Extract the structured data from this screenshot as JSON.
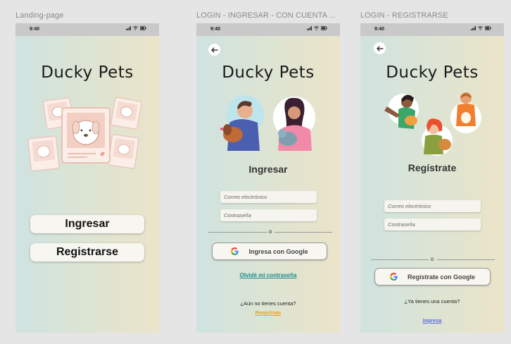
{
  "frames": {
    "landing": {
      "label": "Landing-page"
    },
    "login": {
      "label": "LOGIN - INGRESAR - CON CUENTA ..."
    },
    "register": {
      "label": "LOGIN - REGISTRARSE"
    }
  },
  "status": {
    "time": "9:40"
  },
  "logo": "Ducky Pets",
  "landing": {
    "login_button": "Ingresar",
    "register_button": "Registrarse"
  },
  "login": {
    "title": "Ingresar",
    "email_placeholder": "Correo electrónico",
    "password_placeholder": "Contraseña",
    "divider_text": "o",
    "google_button": "Ingresa con Google",
    "forgot_password": "Olvidé mi contraseña",
    "no_account": "¿Aún no tienes cuenta?",
    "register_link": "Regístrate"
  },
  "register": {
    "title": "Regístrate",
    "email_placeholder": "Correo electrónico",
    "password_placeholder": "Contraseña",
    "divider_text": "o",
    "google_button": "Regístrate con Google",
    "have_account": "¿Ya tienes una cuenta?",
    "login_link": "Ingresa"
  },
  "colors": {
    "forgot_link": "#1a8a8a",
    "register_link": "#f0a020",
    "login_link": "#5b6be0"
  },
  "icons": [
    "back-arrow-icon",
    "google-icon",
    "signal-icon",
    "wifi-icon",
    "battery-icon"
  ]
}
